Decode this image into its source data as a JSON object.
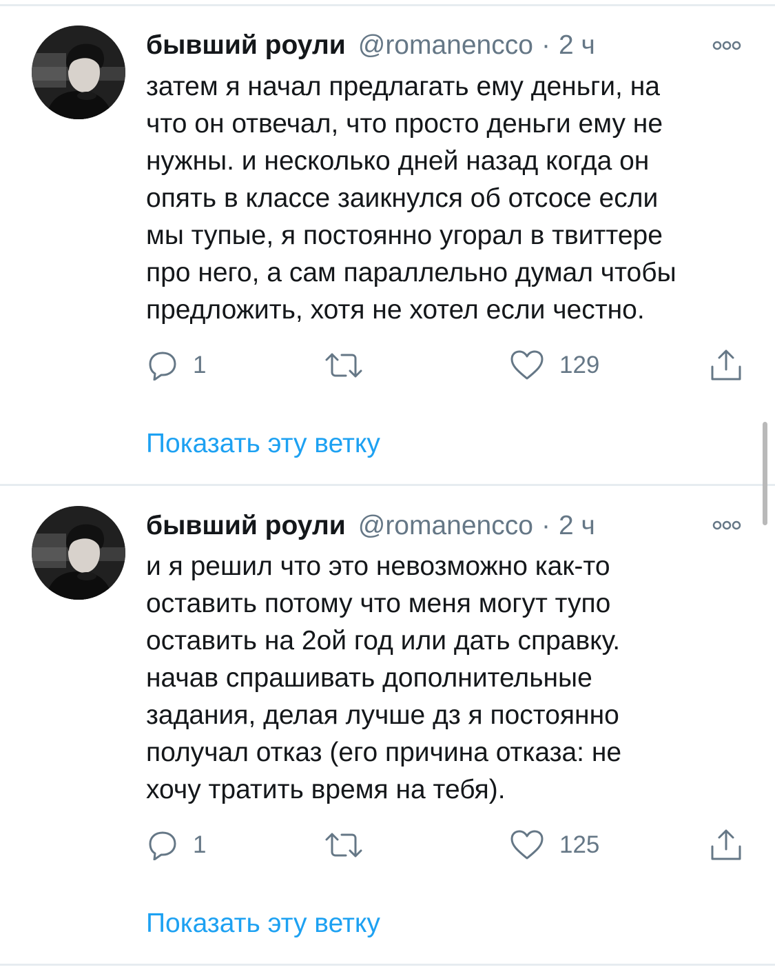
{
  "tweets": [
    {
      "display_name": "бывший роули",
      "handle": "@romanencco",
      "separator": "·",
      "time": "2 ч",
      "text": "затем я начал предлагать ему деньги, на\nчто он отвечал, что просто деньги ему не\nнужны. и несколько дней назад когда он\nопять в классе заикнулся об отсосе если\nмы тупые, я постоянно угорал в твиттере\nпро него, а сам параллельно думал чтобы\nпредложить, хотя не хотел если честно.",
      "replies": "1",
      "likes": "129",
      "show_thread": "Показать эту ветку"
    },
    {
      "display_name": "бывший роули",
      "handle": "@romanencco",
      "separator": "·",
      "time": "2 ч",
      "text": "и я решил что это невозможно как-то\nоставить потому что меня могут тупо\nоставить на 2ой год или дать справку.\nначав спрашивать дополнительные\nзадания, делая лучше дз я постоянно\nполучал отказ (его причина отказа: не\nхочу тратить время на тебя).",
      "replies": "1",
      "likes": "125",
      "show_thread": "Показать эту ветку"
    }
  ],
  "icons": {
    "reply": "reply-icon",
    "retweet": "retweet-icon",
    "like": "heart-icon",
    "share": "share-icon",
    "more": "more-icon"
  },
  "colors": {
    "link": "#1da1f2",
    "secondary_text": "#657786",
    "divider": "#e6ecf0"
  }
}
